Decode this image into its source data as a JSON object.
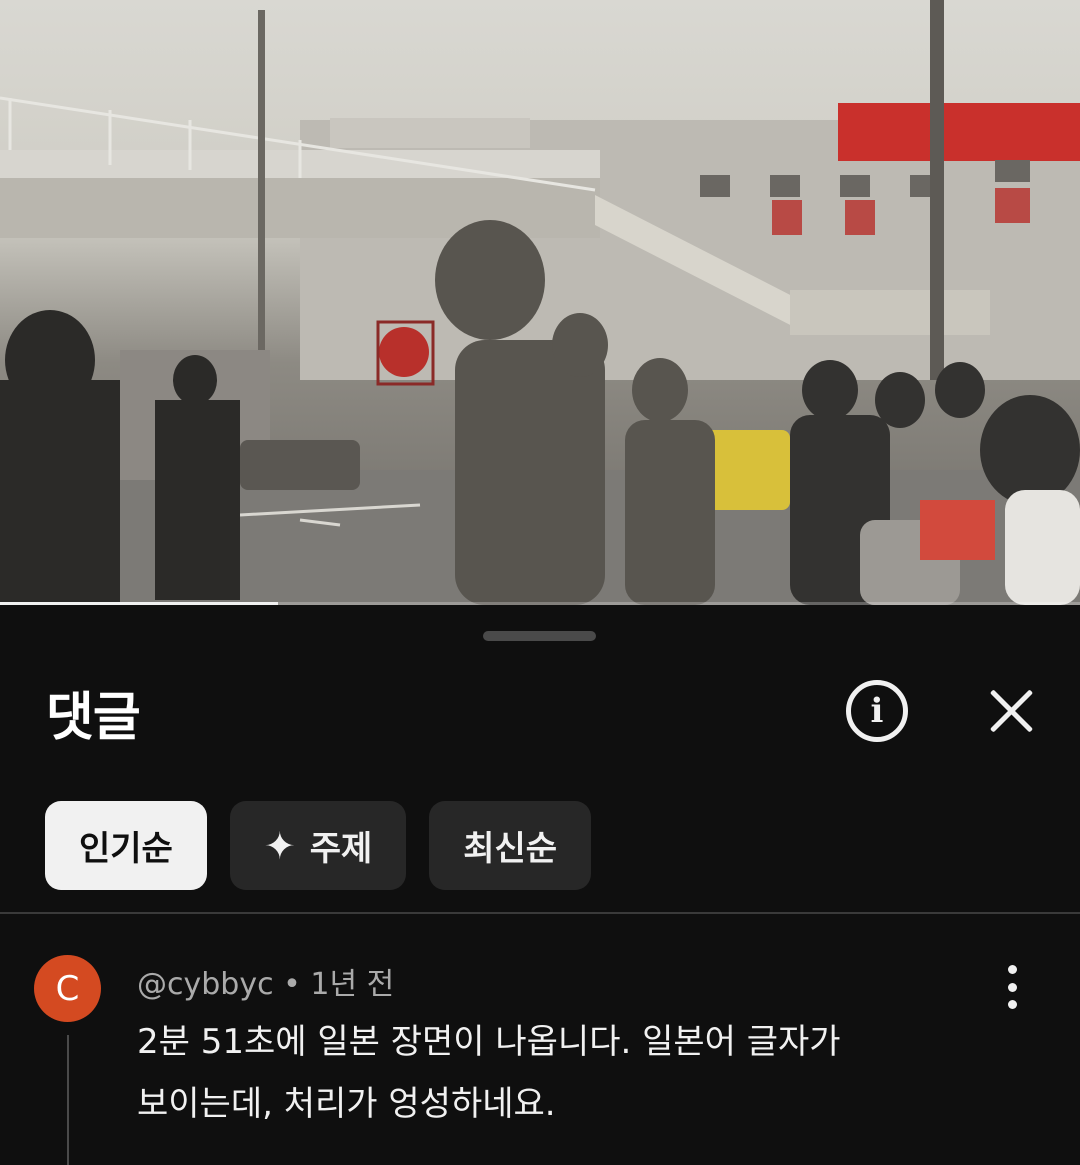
{
  "video": {
    "progress_fraction": 0.257
  },
  "comments_panel": {
    "title": "댓글",
    "info_icon_glyph": "i",
    "sort_chips": [
      {
        "label": "인기순",
        "selected": true
      },
      {
        "label": "주제",
        "icon": "sparkle-icon",
        "selected": false
      },
      {
        "label": "최신순",
        "selected": false
      }
    ],
    "comments": [
      {
        "avatar_letter": "C",
        "avatar_color": "#d44a21",
        "author": "@cybbyc",
        "separator": " • ",
        "time": "1년 전",
        "text_line1": "2분 51초에 일본 장면이 나옵니다. 일본어 글자가",
        "text_line2": "보이는데, 처리가 엉성하네요."
      }
    ]
  },
  "colors": {
    "background": "#0f0f0f",
    "chip_active_bg": "#f1f1f1",
    "chip_bg": "#272727",
    "meta_text": "#aaaaaa"
  }
}
